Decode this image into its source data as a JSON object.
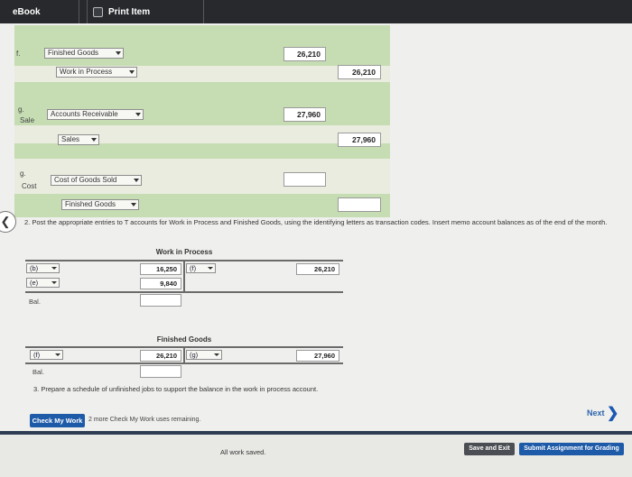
{
  "topbar": {
    "ebook": "eBook",
    "print_item": "Print Item"
  },
  "journal": {
    "f": {
      "letter": "f.",
      "debit_account": "Finished Goods",
      "credit_account": "Work in Process",
      "debit_amount": "26,210",
      "credit_amount": "26,210"
    },
    "g_sale": {
      "letter": "g.",
      "label": "Sale",
      "debit_account": "Accounts Receivable",
      "credit_account": "Sales",
      "debit_amount": "27,960",
      "credit_amount": "27,960"
    },
    "g_cost": {
      "letter": "g.",
      "label": "Cost",
      "debit_account": "Cost of Goods Sold",
      "credit_account": "Finished Goods",
      "debit_amount": "",
      "credit_amount": ""
    }
  },
  "question2": "2. Post the appropriate entries to T accounts for Work in Process and Finished Goods, using the identifying letters as transaction codes. Insert memo account balances as of the end of the month.",
  "wip": {
    "title": "Work in Process",
    "debits": [
      {
        "code": "(b)",
        "amount": "16,250"
      },
      {
        "code": "(e)",
        "amount": "9,840"
      }
    ],
    "credit_code": "(f)",
    "credit_amount": "26,210",
    "bal_label": "Bal."
  },
  "fg": {
    "title": "Finished Goods",
    "debit_code": "(f)",
    "debit_amount": "26,210",
    "credit_code": "(g)",
    "credit_amount": "27,960",
    "bal_label": "Bal."
  },
  "question3": "3. Prepare a schedule of unfinished jobs to support the balance in the work in process account.",
  "check": {
    "button": "Check My Work",
    "note": "2 more Check My Work uses remaining."
  },
  "next": "Next",
  "footer": {
    "saved": "All work saved.",
    "save_exit": "Save and Exit",
    "submit": "Submit Assignment for Grading"
  }
}
